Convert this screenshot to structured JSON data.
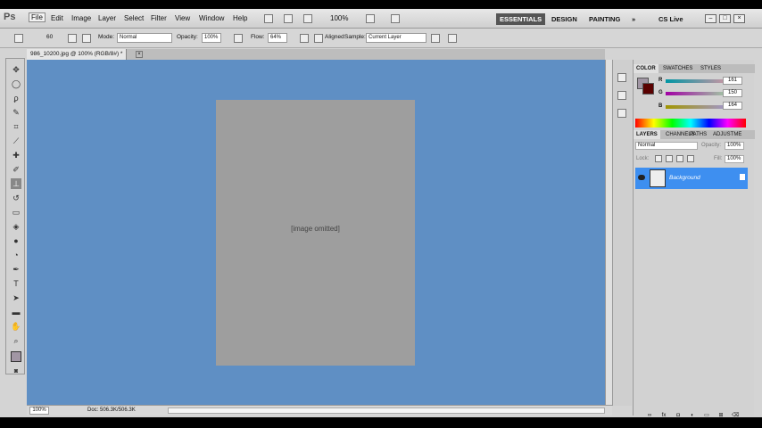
{
  "app": {
    "logo": "Ps",
    "status_flag": "CS Live"
  },
  "menu": [
    "File",
    "Edit",
    "Image",
    "Layer",
    "Select",
    "Filter",
    "View",
    "Window",
    "Help"
  ],
  "appbar": {
    "zoom": "100%"
  },
  "workspaces": [
    "ESSENTIALS",
    "DESIGN",
    "PAINTING"
  ],
  "options": {
    "brush_size": "60",
    "mode_label": "Mode:",
    "mode": "Normal",
    "opacity_label": "Opacity:",
    "opacity": "100%",
    "flow_label": "Flow:",
    "flow": "64%",
    "aligned_label": "Aligned",
    "sample_label": "Sample:",
    "sample": "Current Layer"
  },
  "document": {
    "tab_title": "986_10200.jpg @ 100% (RGB/8#) *",
    "placeholder": "[image omitted]"
  },
  "status": {
    "zoom": "100%",
    "doc_size": "Doc: 506.3K/506.3K"
  },
  "color_panel": {
    "tabs": [
      "COLOR",
      "SWATCHES",
      "STYLES"
    ],
    "r_label": "R",
    "r": "161",
    "g_label": "G",
    "g": "150",
    "b_label": "B",
    "b": "164",
    "foreground": "#a196a4"
  },
  "layers_panel": {
    "tabs": [
      "LAYERS",
      "CHANNELS",
      "PATHS",
      "ADJUSTME"
    ],
    "blend_mode": "Normal",
    "opacity_label": "Opacity:",
    "opacity": "100%",
    "lock_label": "Lock:",
    "fill_label": "Fill:",
    "fill": "100%",
    "layer_name": "Background"
  },
  "colors": {
    "canvas_bg": "#5f8fc4",
    "selected_layer": "#3e8ff0",
    "active_workspace": "#555555"
  }
}
